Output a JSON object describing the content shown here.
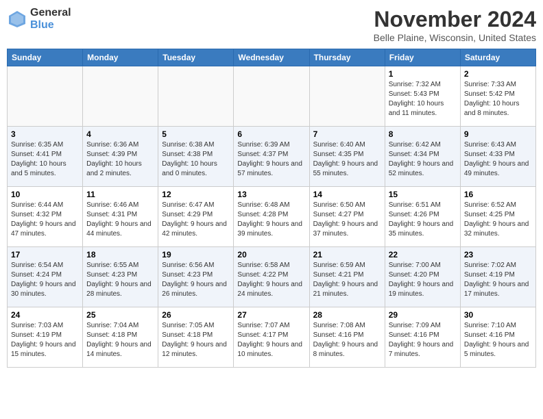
{
  "header": {
    "logo_general": "General",
    "logo_blue": "Blue",
    "month_title": "November 2024",
    "location": "Belle Plaine, Wisconsin, United States"
  },
  "days_of_week": [
    "Sunday",
    "Monday",
    "Tuesday",
    "Wednesday",
    "Thursday",
    "Friday",
    "Saturday"
  ],
  "weeks": [
    {
      "alt": false,
      "days": [
        {
          "num": "",
          "info": ""
        },
        {
          "num": "",
          "info": ""
        },
        {
          "num": "",
          "info": ""
        },
        {
          "num": "",
          "info": ""
        },
        {
          "num": "",
          "info": ""
        },
        {
          "num": "1",
          "info": "Sunrise: 7:32 AM\nSunset: 5:43 PM\nDaylight: 10 hours and 11 minutes."
        },
        {
          "num": "2",
          "info": "Sunrise: 7:33 AM\nSunset: 5:42 PM\nDaylight: 10 hours and 8 minutes."
        }
      ]
    },
    {
      "alt": true,
      "days": [
        {
          "num": "3",
          "info": "Sunrise: 6:35 AM\nSunset: 4:41 PM\nDaylight: 10 hours and 5 minutes."
        },
        {
          "num": "4",
          "info": "Sunrise: 6:36 AM\nSunset: 4:39 PM\nDaylight: 10 hours and 2 minutes."
        },
        {
          "num": "5",
          "info": "Sunrise: 6:38 AM\nSunset: 4:38 PM\nDaylight: 10 hours and 0 minutes."
        },
        {
          "num": "6",
          "info": "Sunrise: 6:39 AM\nSunset: 4:37 PM\nDaylight: 9 hours and 57 minutes."
        },
        {
          "num": "7",
          "info": "Sunrise: 6:40 AM\nSunset: 4:35 PM\nDaylight: 9 hours and 55 minutes."
        },
        {
          "num": "8",
          "info": "Sunrise: 6:42 AM\nSunset: 4:34 PM\nDaylight: 9 hours and 52 minutes."
        },
        {
          "num": "9",
          "info": "Sunrise: 6:43 AM\nSunset: 4:33 PM\nDaylight: 9 hours and 49 minutes."
        }
      ]
    },
    {
      "alt": false,
      "days": [
        {
          "num": "10",
          "info": "Sunrise: 6:44 AM\nSunset: 4:32 PM\nDaylight: 9 hours and 47 minutes."
        },
        {
          "num": "11",
          "info": "Sunrise: 6:46 AM\nSunset: 4:31 PM\nDaylight: 9 hours and 44 minutes."
        },
        {
          "num": "12",
          "info": "Sunrise: 6:47 AM\nSunset: 4:29 PM\nDaylight: 9 hours and 42 minutes."
        },
        {
          "num": "13",
          "info": "Sunrise: 6:48 AM\nSunset: 4:28 PM\nDaylight: 9 hours and 39 minutes."
        },
        {
          "num": "14",
          "info": "Sunrise: 6:50 AM\nSunset: 4:27 PM\nDaylight: 9 hours and 37 minutes."
        },
        {
          "num": "15",
          "info": "Sunrise: 6:51 AM\nSunset: 4:26 PM\nDaylight: 9 hours and 35 minutes."
        },
        {
          "num": "16",
          "info": "Sunrise: 6:52 AM\nSunset: 4:25 PM\nDaylight: 9 hours and 32 minutes."
        }
      ]
    },
    {
      "alt": true,
      "days": [
        {
          "num": "17",
          "info": "Sunrise: 6:54 AM\nSunset: 4:24 PM\nDaylight: 9 hours and 30 minutes."
        },
        {
          "num": "18",
          "info": "Sunrise: 6:55 AM\nSunset: 4:23 PM\nDaylight: 9 hours and 28 minutes."
        },
        {
          "num": "19",
          "info": "Sunrise: 6:56 AM\nSunset: 4:23 PM\nDaylight: 9 hours and 26 minutes."
        },
        {
          "num": "20",
          "info": "Sunrise: 6:58 AM\nSunset: 4:22 PM\nDaylight: 9 hours and 24 minutes."
        },
        {
          "num": "21",
          "info": "Sunrise: 6:59 AM\nSunset: 4:21 PM\nDaylight: 9 hours and 21 minutes."
        },
        {
          "num": "22",
          "info": "Sunrise: 7:00 AM\nSunset: 4:20 PM\nDaylight: 9 hours and 19 minutes."
        },
        {
          "num": "23",
          "info": "Sunrise: 7:02 AM\nSunset: 4:19 PM\nDaylight: 9 hours and 17 minutes."
        }
      ]
    },
    {
      "alt": false,
      "days": [
        {
          "num": "24",
          "info": "Sunrise: 7:03 AM\nSunset: 4:19 PM\nDaylight: 9 hours and 15 minutes."
        },
        {
          "num": "25",
          "info": "Sunrise: 7:04 AM\nSunset: 4:18 PM\nDaylight: 9 hours and 14 minutes."
        },
        {
          "num": "26",
          "info": "Sunrise: 7:05 AM\nSunset: 4:18 PM\nDaylight: 9 hours and 12 minutes."
        },
        {
          "num": "27",
          "info": "Sunrise: 7:07 AM\nSunset: 4:17 PM\nDaylight: 9 hours and 10 minutes."
        },
        {
          "num": "28",
          "info": "Sunrise: 7:08 AM\nSunset: 4:16 PM\nDaylight: 9 hours and 8 minutes."
        },
        {
          "num": "29",
          "info": "Sunrise: 7:09 AM\nSunset: 4:16 PM\nDaylight: 9 hours and 7 minutes."
        },
        {
          "num": "30",
          "info": "Sunrise: 7:10 AM\nSunset: 4:16 PM\nDaylight: 9 hours and 5 minutes."
        }
      ]
    }
  ]
}
